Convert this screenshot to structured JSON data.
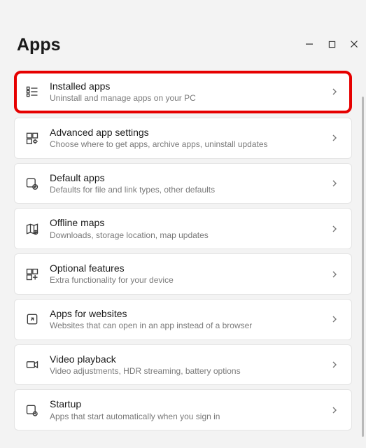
{
  "page_title": "Apps",
  "items": [
    {
      "name": "installed-apps",
      "title": "Installed apps",
      "desc": "Uninstall and manage apps on your PC",
      "highlighted": true
    },
    {
      "name": "advanced-app-settings",
      "title": "Advanced app settings",
      "desc": "Choose where to get apps, archive apps, uninstall updates",
      "highlighted": false
    },
    {
      "name": "default-apps",
      "title": "Default apps",
      "desc": "Defaults for file and link types, other defaults",
      "highlighted": false
    },
    {
      "name": "offline-maps",
      "title": "Offline maps",
      "desc": "Downloads, storage location, map updates",
      "highlighted": false
    },
    {
      "name": "optional-features",
      "title": "Optional features",
      "desc": "Extra functionality for your device",
      "highlighted": false
    },
    {
      "name": "apps-for-websites",
      "title": "Apps for websites",
      "desc": "Websites that can open in an app instead of a browser",
      "highlighted": false
    },
    {
      "name": "video-playback",
      "title": "Video playback",
      "desc": "Video adjustments, HDR streaming, battery options",
      "highlighted": false
    },
    {
      "name": "startup",
      "title": "Startup",
      "desc": "Apps that start automatically when you sign in",
      "highlighted": false
    }
  ]
}
